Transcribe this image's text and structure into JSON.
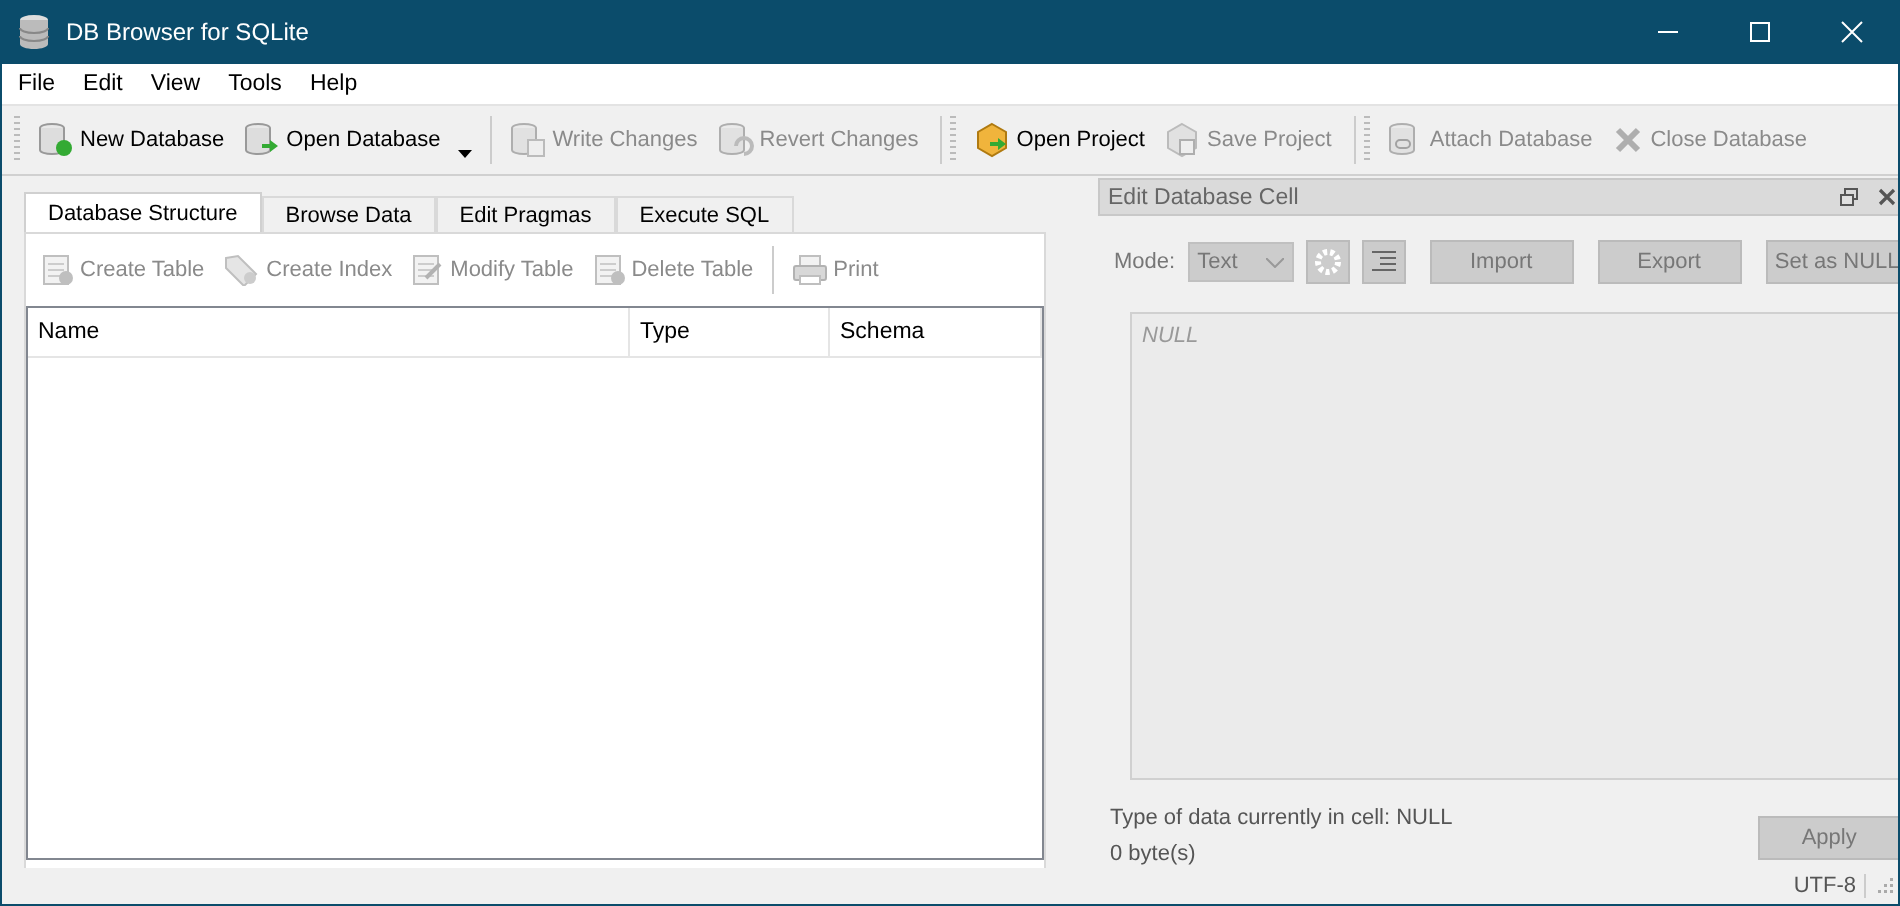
{
  "window": {
    "title": "DB Browser for SQLite"
  },
  "menu": [
    "File",
    "Edit",
    "View",
    "Tools",
    "Help"
  ],
  "toolbar": [
    {
      "label": "New Database",
      "disabled": false,
      "dropdown": false
    },
    {
      "label": "Open Database",
      "disabled": false,
      "dropdown": true
    },
    {
      "label": "Write Changes",
      "disabled": true,
      "dropdown": false
    },
    {
      "label": "Revert Changes",
      "disabled": true,
      "dropdown": false
    },
    {
      "label": "Open Project",
      "disabled": false,
      "dropdown": false
    },
    {
      "label": "Save Project",
      "disabled": true,
      "dropdown": false
    },
    {
      "label": "Attach Database",
      "disabled": true,
      "dropdown": false
    },
    {
      "label": "Close Database",
      "disabled": true,
      "dropdown": false
    }
  ],
  "tabs": [
    {
      "label": "Database Structure",
      "selected": true
    },
    {
      "label": "Browse Data",
      "selected": false
    },
    {
      "label": "Edit Pragmas",
      "selected": false
    },
    {
      "label": "Execute SQL",
      "selected": false
    }
  ],
  "structure_toolbar": [
    {
      "label": "Create Table",
      "disabled": true
    },
    {
      "label": "Create Index",
      "disabled": true
    },
    {
      "label": "Modify Table",
      "disabled": true
    },
    {
      "label": "Delete Table",
      "disabled": true
    },
    {
      "label": "Print",
      "disabled": true
    }
  ],
  "tree": {
    "columns": [
      "Name",
      "Type",
      "Schema"
    ]
  },
  "edit_cell": {
    "title": "Edit Database Cell",
    "mode_label": "Mode:",
    "mode": "Text",
    "buttons": [
      {
        "label": "Import",
        "disabled": true
      },
      {
        "label": "Export",
        "disabled": true
      },
      {
        "label": "Set as NULL",
        "disabled": true
      }
    ],
    "placeholder": "NULL",
    "type_info": "Type of data currently in cell: NULL",
    "size_info": "0 byte(s)",
    "apply": {
      "label": "Apply",
      "disabled": true
    }
  },
  "status_bar": {
    "encoding": "UTF-8"
  }
}
